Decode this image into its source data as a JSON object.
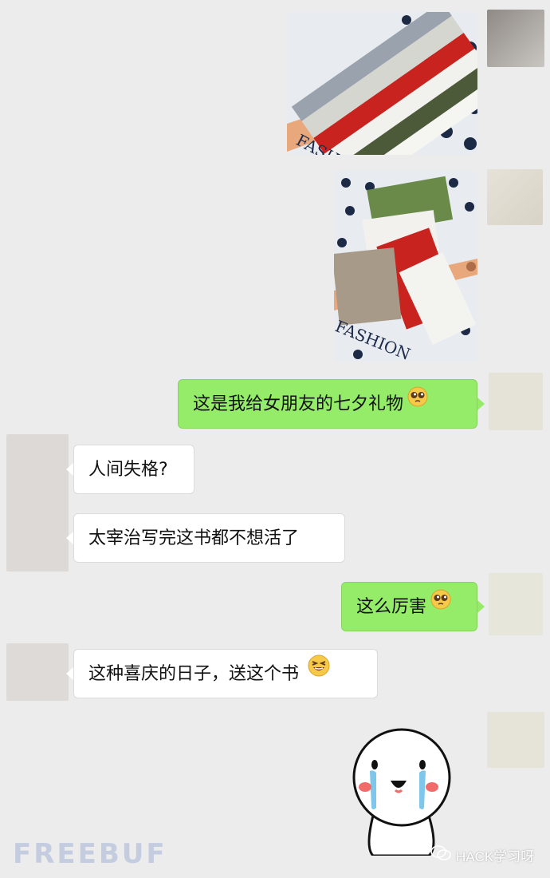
{
  "messages": {
    "m1": {
      "text": "这是我给女朋友的七夕礼物",
      "emoji": "pleading-face-emoji"
    },
    "m2": {
      "text": "人间失格?"
    },
    "m3": {
      "text": "太宰治写完这书都不想活了"
    },
    "m4": {
      "text": "这么厉害",
      "emoji": "pleading-face-emoji"
    },
    "m5": {
      "text": "这种喜庆的日子，送这个书",
      "emoji": "grinning-squinting-face-emoji"
    }
  },
  "images": {
    "photo1": {
      "cover_text": "FASHION"
    },
    "photo2": {
      "cover_text": "FASHION"
    }
  },
  "watermarks": {
    "freebuf": "FREEBUF",
    "account": "HACK学习呀"
  },
  "colors": {
    "background": "#ececec",
    "sent_bubble": "#95ec69",
    "received_bubble": "#ffffff"
  }
}
